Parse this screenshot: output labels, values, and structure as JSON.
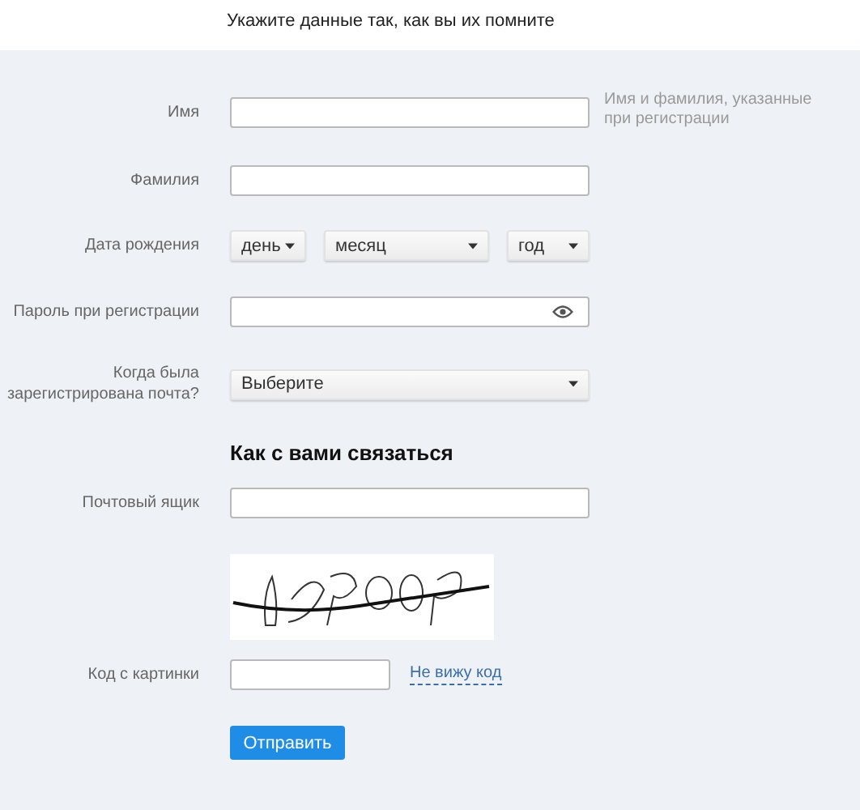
{
  "intro": "Укажите данные так, как вы их помните",
  "fields": [
    {
      "kind": "text",
      "label": "Имя",
      "hint": "Имя и фамилия, указанные при регистрации"
    },
    {
      "kind": "text",
      "label": "Фамилия"
    },
    {
      "kind": "date",
      "label": "Дата рождения",
      "selects": [
        "день",
        "месяц",
        "год"
      ]
    },
    {
      "kind": "password",
      "label": "Пароль при регистрации"
    },
    {
      "kind": "select",
      "label": "Когда была зарегистрирована почта?",
      "value": "Выберите"
    }
  ],
  "section_title": "Как с вами связаться",
  "contact_fields": [
    {
      "kind": "text",
      "label": "Почтовый ящик"
    },
    {
      "kind": "captcha"
    },
    {
      "kind": "code",
      "label": "Код с картинки",
      "link": "Не вижу код"
    }
  ],
  "submit": "Отправить"
}
